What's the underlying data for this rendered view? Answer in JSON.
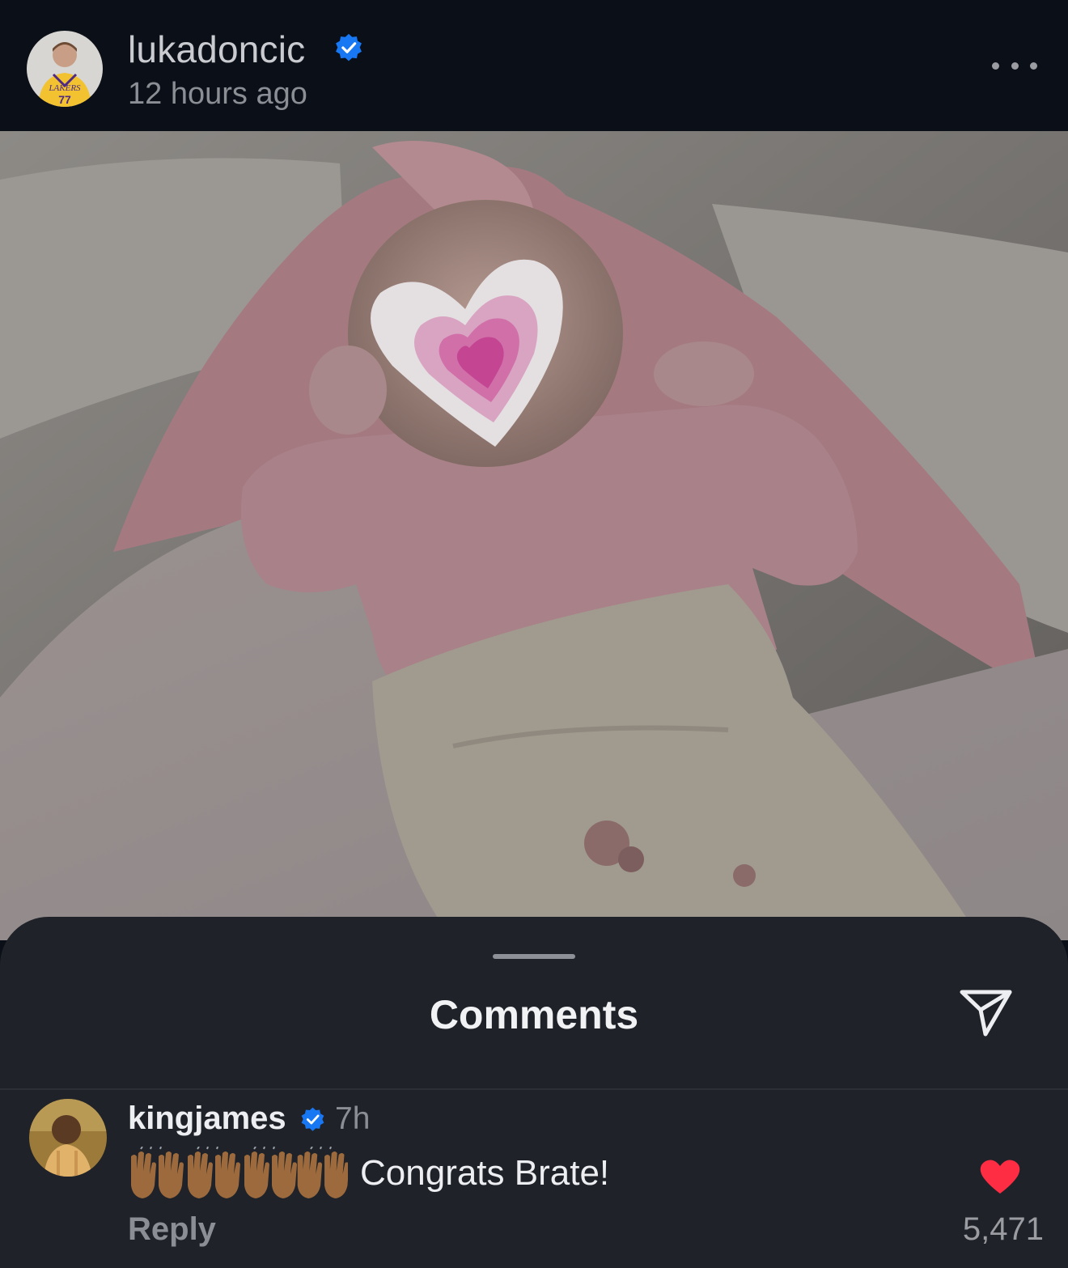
{
  "post": {
    "username": "lukadoncic",
    "verified": true,
    "timestamp": "12 hours ago",
    "avatar_icon": "profile-photo-lakers-jersey",
    "more_icon": "more-horizontal-icon"
  },
  "photo": {
    "subject": "newborn baby in pink outfit, face covered by a pink heart emoji"
  },
  "comments_sheet": {
    "title": "Comments",
    "share_icon": "send-icon",
    "comments": [
      {
        "username": "kingjames",
        "verified": true,
        "time": "7h",
        "emoji": "🙌🏾🙌🏾🙌🏾🙌🏾",
        "text": "Congrats Brate!",
        "reply_label": "Reply",
        "liked": true,
        "like_count": "5,471"
      }
    ]
  },
  "colors": {
    "background": "#0b0f17",
    "sheet": "#1f2228",
    "verified_blue": "#1877f2",
    "like_red": "#ff2d44"
  }
}
